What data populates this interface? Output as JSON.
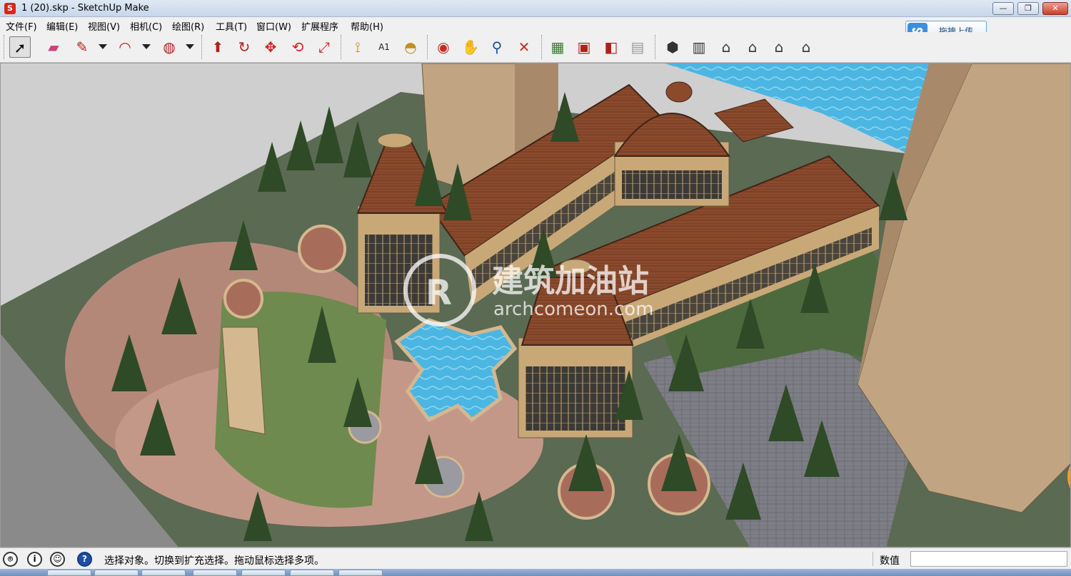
{
  "window": {
    "title": "1 (20).skp - SketchUp Make",
    "app_icon": "sketchup-logo-icon",
    "controls": {
      "minimize": "—",
      "maximize": "❐",
      "close": "✕"
    }
  },
  "menu": {
    "items": [
      "文件(F)",
      "编辑(E)",
      "视图(V)",
      "相机(C)",
      "绘图(R)",
      "工具(T)",
      "窗口(W)",
      "扩展程序",
      "帮助(H)"
    ]
  },
  "upload": {
    "label": "拖拽上传",
    "icon": "cloud-upload-icon"
  },
  "toolbar": {
    "tools": [
      {
        "name": "select-tool",
        "glyph": "➚",
        "active": true
      },
      {
        "name": "eraser-tool",
        "glyph": "▰"
      },
      {
        "name": "line-tool",
        "glyph": "✎"
      },
      {
        "name": "arc-tool",
        "glyph": "◠"
      },
      {
        "name": "shape-tool",
        "glyph": "◍"
      },
      {
        "name": "push-pull-tool",
        "glyph": "⬆"
      },
      {
        "name": "follow-me-tool",
        "glyph": "↻"
      },
      {
        "name": "move-tool",
        "glyph": "✥"
      },
      {
        "name": "rotate-tool",
        "glyph": "⟲"
      },
      {
        "name": "scale-tool",
        "glyph": "⤢"
      },
      {
        "name": "tape-measure-tool",
        "glyph": "⟟"
      },
      {
        "name": "text-tool",
        "glyph": "A1"
      },
      {
        "name": "paint-bucket-tool",
        "glyph": "◓"
      },
      {
        "name": "orbit-tool",
        "glyph": "◉"
      },
      {
        "name": "pan-tool",
        "glyph": "✋"
      },
      {
        "name": "zoom-tool",
        "glyph": "⚲"
      },
      {
        "name": "zoom-extents-tool",
        "glyph": "✕"
      },
      {
        "name": "add-location-tool",
        "glyph": "▦"
      },
      {
        "name": "3d-warehouse-tool",
        "glyph": "▣"
      },
      {
        "name": "share-model-tool",
        "glyph": "◧"
      },
      {
        "name": "extension-warehouse-tool",
        "glyph": "▤"
      },
      {
        "name": "iso-view",
        "glyph": "⬢"
      },
      {
        "name": "top-view",
        "glyph": "▥"
      },
      {
        "name": "front-view",
        "glyph": "⌂"
      },
      {
        "name": "right-view",
        "glyph": "⌂"
      },
      {
        "name": "back-view",
        "glyph": "⌂"
      },
      {
        "name": "left-view",
        "glyph": "⌂"
      }
    ]
  },
  "viewport": {
    "watermark_text": "建筑加油站",
    "watermark_sub": "archcomeon.com"
  },
  "status": {
    "message": "选择对象。切换到扩充选择。拖动鼠标选择多项。",
    "measurements_label": "数值",
    "measurements_value": ""
  },
  "colors": {
    "roof": "#8a4a2e",
    "wall": "#c9a878",
    "water": "#4bb3e0",
    "lawn": "#5d7a4a",
    "paving": "#b98a78",
    "tower": "#c1a582"
  }
}
